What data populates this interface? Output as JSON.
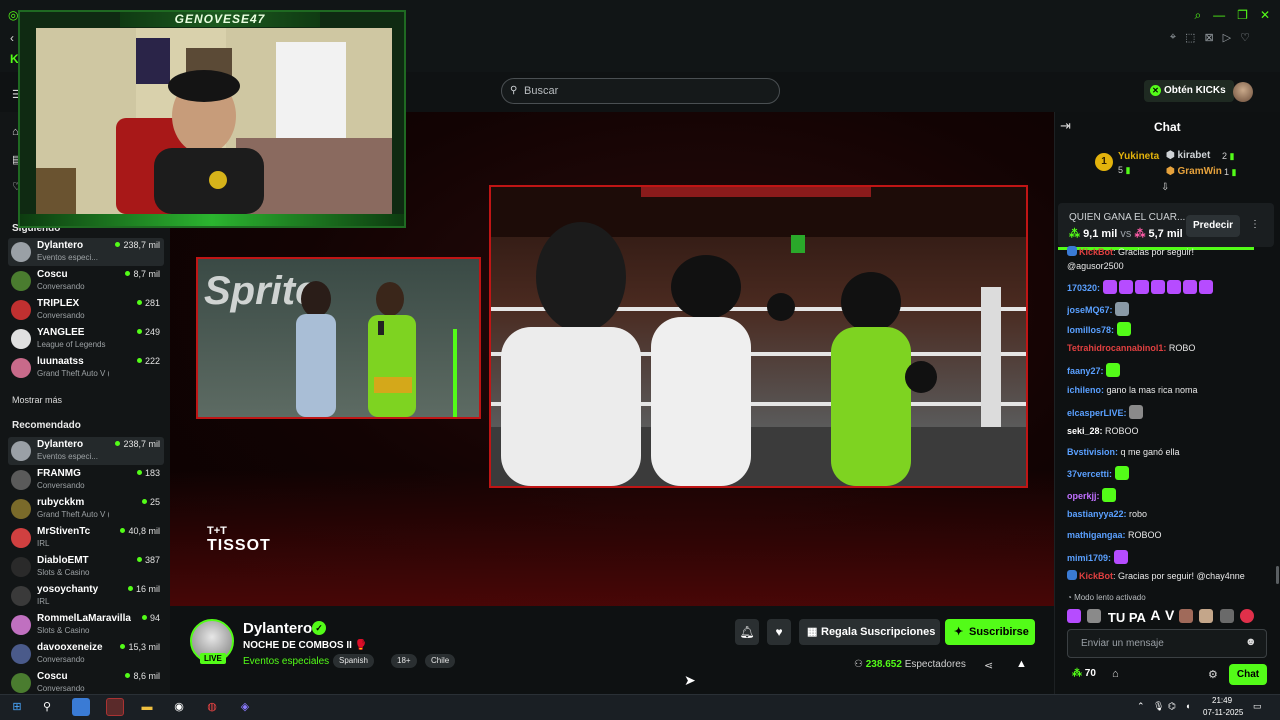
{
  "webcam": {
    "streamer_banner": "GENOVESE47"
  },
  "search": {
    "placeholder": "Buscar"
  },
  "header": {
    "get_kicks_label": "Obtén KICKs"
  },
  "sidebar": {
    "following_label": "Siguiendo",
    "following": [
      {
        "name": "Dylantero",
        "category": "Eventos especi...",
        "viewers": "238,7 mil",
        "active": true,
        "avatar_color": "#9aa0a6"
      },
      {
        "name": "Coscu",
        "category": "Conversando",
        "viewers": "8,7 mil",
        "avatar_color": "#4a7c2f"
      },
      {
        "name": "TRIPLEX",
        "category": "Conversando",
        "viewers": "281",
        "avatar_color": "#c03030"
      },
      {
        "name": "YANGLEE",
        "category": "League of Legends",
        "viewers": "249",
        "avatar_color": "#e0e0e0"
      },
      {
        "name": "luunaatss",
        "category": "Grand Theft Auto V (G...",
        "viewers": "222",
        "avatar_color": "#c86a8a"
      }
    ],
    "show_more_label": "Mostrar más",
    "recommended_label": "Recomendado",
    "recommended": [
      {
        "name": "Dylantero",
        "category": "Eventos especi...",
        "viewers": "238,7 mil",
        "active": true,
        "avatar_color": "#9aa0a6"
      },
      {
        "name": "FRANMG",
        "category": "Conversando",
        "viewers": "183",
        "avatar_color": "#5a5a5a"
      },
      {
        "name": "rubyckkm",
        "category": "Grand Theft Auto V (GTA)",
        "viewers": "25",
        "avatar_color": "#7a6a2a"
      },
      {
        "name": "MrStivenTc",
        "category": "IRL",
        "viewers": "40,8 mil",
        "avatar_color": "#d04040"
      },
      {
        "name": "DiabloEMT",
        "category": "Slots & Casino",
        "viewers": "387",
        "avatar_color": "#2a2a2a"
      },
      {
        "name": "yosoychanty",
        "category": "IRL",
        "viewers": "16 mil",
        "avatar_color": "#3a3a3a"
      },
      {
        "name": "RommelLaMaravilla",
        "category": "Slots & Casino",
        "viewers": "94",
        "avatar_color": "#c070c0"
      },
      {
        "name": "davooxeneize",
        "category": "Conversando",
        "viewers": "15,3 mil",
        "avatar_color": "#4a5a8a"
      },
      {
        "name": "Coscu",
        "category": "Conversando",
        "viewers": "8,6 mil",
        "avatar_color": "#4a7c2f"
      }
    ]
  },
  "video": {
    "sponsor_text": "TISSOT",
    "sponsor_logo": "T+T",
    "sprite_text": "Sprite"
  },
  "stream": {
    "channel_name": "Dylantero",
    "live_badge": "LIVE",
    "title": "NOCHE DE COMBOS II 🥊",
    "category": "Eventos especiales",
    "tags": [
      "Spanish",
      "18+",
      "Chile"
    ],
    "gift_label": "Regala Suscripciones",
    "subscribe_label": "Suscribirse",
    "viewers_count": "238.652",
    "viewers_label": "Espectadores"
  },
  "chat": {
    "title": "Chat",
    "leaderboard": {
      "first": {
        "rank": "1",
        "name": "Yukineta",
        "count": "5"
      },
      "second": {
        "name": "kirabet",
        "count": "2"
      },
      "third": {
        "name": "GramWin",
        "count": "1"
      }
    },
    "prediction": {
      "question": "QUIEN GANA EL CUAR...",
      "left": "9,1 mil",
      "vs": "vs",
      "right": "5,7 mil",
      "button": "Predecir"
    },
    "messages": [
      {
        "user": "KickBot",
        "user_color": "#e04040",
        "text": ": Gracias por seguir!",
        "badge": true
      },
      {
        "user": "",
        "user_color": "#ffffff",
        "text": "@agusor2500"
      },
      {
        "user": "170320:",
        "user_color": "#5aa0ff",
        "text": "",
        "emotes": 7,
        "emote_color": "#b64cff"
      },
      {
        "user": "joseMQ67:",
        "user_color": "#5aa0ff",
        "text": "",
        "emotes": 1,
        "emote_color": "#8a9aa6"
      },
      {
        "user": "lomillos78:",
        "user_color": "#5aa0ff",
        "text": "",
        "emotes": 1,
        "emote_color": "#53fc18"
      },
      {
        "user": "Tetrahidrocannabinol1:",
        "user_color": "#e04040",
        "text": " ROBO"
      },
      {
        "user": "faany27:",
        "user_color": "#5aa0ff",
        "text": "",
        "emotes": 1,
        "emote_color": "#53fc18"
      },
      {
        "user": "ichileno:",
        "user_color": "#5aa0ff",
        "text": " gano la mas rica noma"
      },
      {
        "user": "elcasperLIVE:",
        "user_color": "#5aa0ff",
        "text": "",
        "emotes": 1,
        "emote_color": "#8a8a8a"
      },
      {
        "user": "seki_28:",
        "user_color": "#ffffff",
        "text": " ROBOO"
      },
      {
        "user": "Bvstivision:",
        "user_color": "#5aa0ff",
        "text": " q me ganó ella"
      },
      {
        "user": "37vercetti:",
        "user_color": "#5aa0ff",
        "text": "",
        "emotes": 1,
        "emote_color": "#53fc18"
      },
      {
        "user": "operkjj:",
        "user_color": "#c070ff",
        "text": "",
        "emotes": 1,
        "emote_color": "#53fc18"
      },
      {
        "user": "bastianyya22:",
        "user_color": "#5aa0ff",
        "text": " robo"
      },
      {
        "user": "mathigangaa:",
        "user_color": "#5aa0ff",
        "text": " ROBOO"
      },
      {
        "user": "mimi1709:",
        "user_color": "#5aa0ff",
        "text": "",
        "emotes": 1,
        "emote_color": "#b64cff"
      },
      {
        "user": "KickBot",
        "user_color": "#e04040",
        "text": ": Gracias por seguir! @chay4nne",
        "badge": true
      }
    ],
    "slow_mode": "Modo lento activado",
    "emote_text": "TU PA",
    "input_placeholder": "Enviar un mensaje",
    "points": "70",
    "send_label": "Chat"
  },
  "taskbar": {
    "time": "21:49",
    "date": "07-11-2025"
  },
  "colors": {
    "accent": "#53fc18",
    "danger": "#c01515"
  }
}
